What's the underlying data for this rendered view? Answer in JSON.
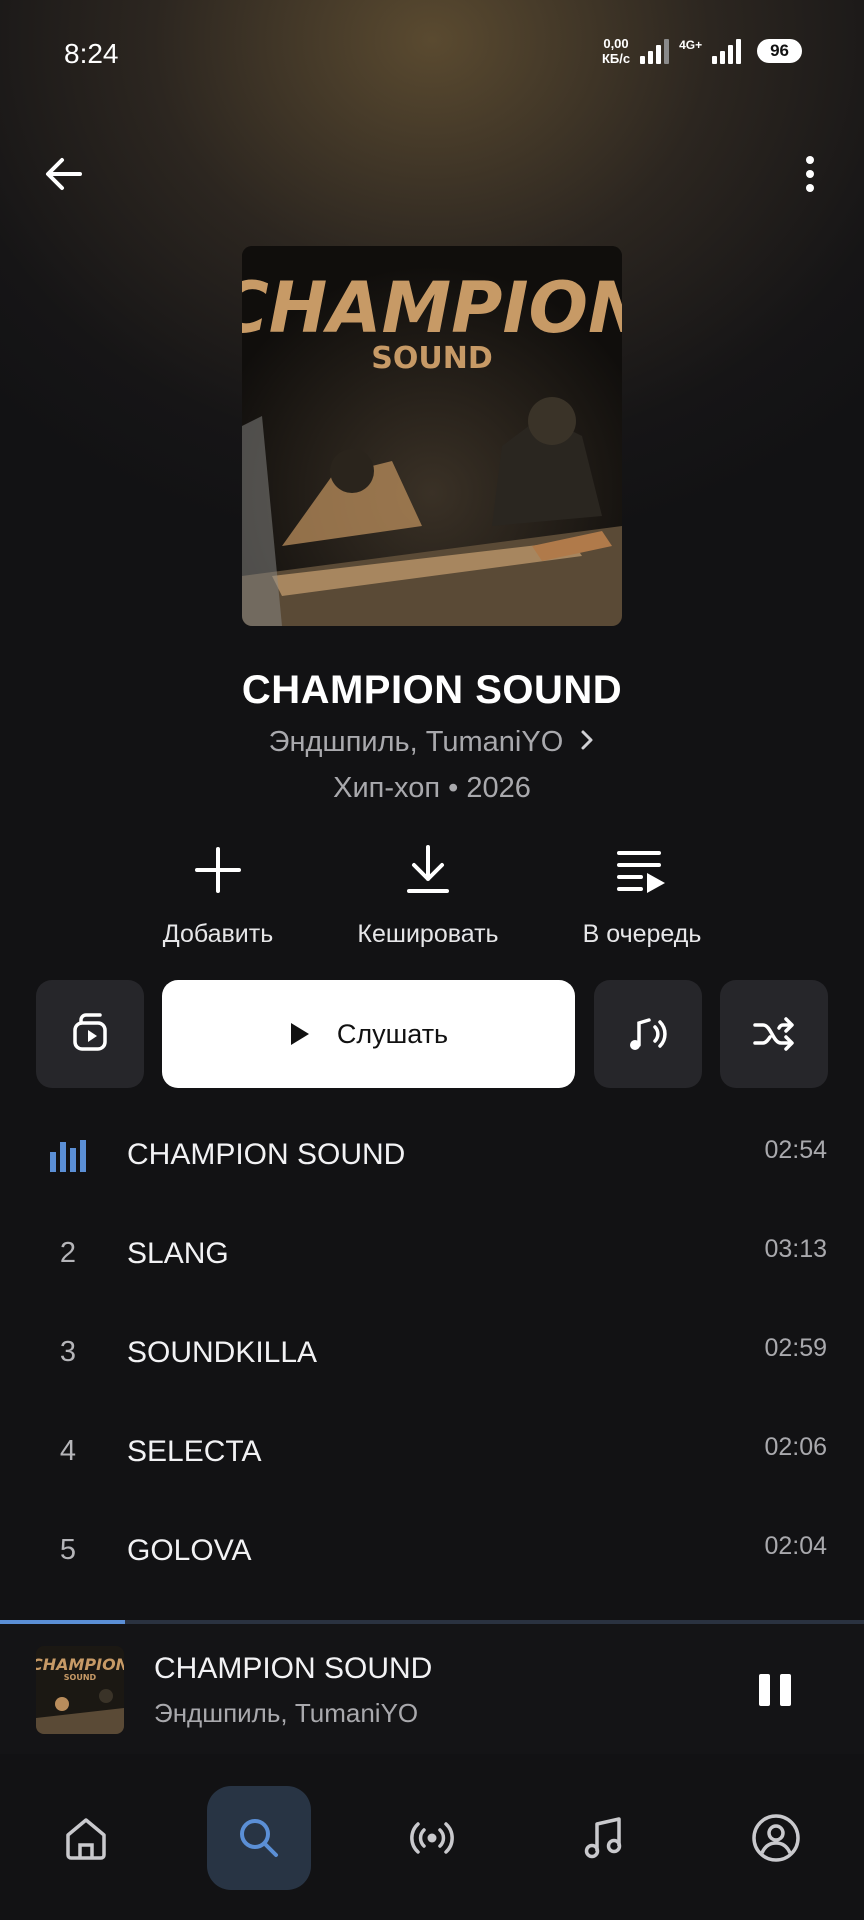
{
  "status_bar": {
    "time": "8:24",
    "net_speed_value": "0,00",
    "net_speed_unit": "КБ/с",
    "network_type": "4G+",
    "battery": "96"
  },
  "album": {
    "cover_title_line1": "CHAMPION",
    "cover_title_line2": "SOUND",
    "title": "CHAMPION SOUND",
    "artist": "Эндшпиль, TumaniYO",
    "meta": "Хип-хоп • 2026"
  },
  "actions": {
    "add_label": "Добавить",
    "cache_label": "Кешировать",
    "queue_label": "В очередь"
  },
  "play_button_label": "Слушать",
  "tracks": [
    {
      "number": "",
      "title": "CHAMPION SOUND",
      "duration": "02:54",
      "now_playing": true
    },
    {
      "number": "2",
      "title": "SLANG",
      "duration": "03:13"
    },
    {
      "number": "3",
      "title": "SOUNDKILLA",
      "duration": "02:59"
    },
    {
      "number": "4",
      "title": "SELECTA",
      "duration": "02:06"
    },
    {
      "number": "5",
      "title": "GOLOVA",
      "duration": "02:04"
    }
  ],
  "mini_player": {
    "title": "CHAMPION SOUND",
    "artist": "Эндшпиль, TumaniYO",
    "progress_fraction": 0.145
  },
  "bottom_nav": {
    "items": [
      "home-icon",
      "search-icon",
      "radio-icon",
      "music-note-icon",
      "profile-icon"
    ],
    "active": "search-icon"
  },
  "colors": {
    "accent": "#5b8fd6",
    "background": "#121214",
    "button_bg": "#26262a"
  }
}
